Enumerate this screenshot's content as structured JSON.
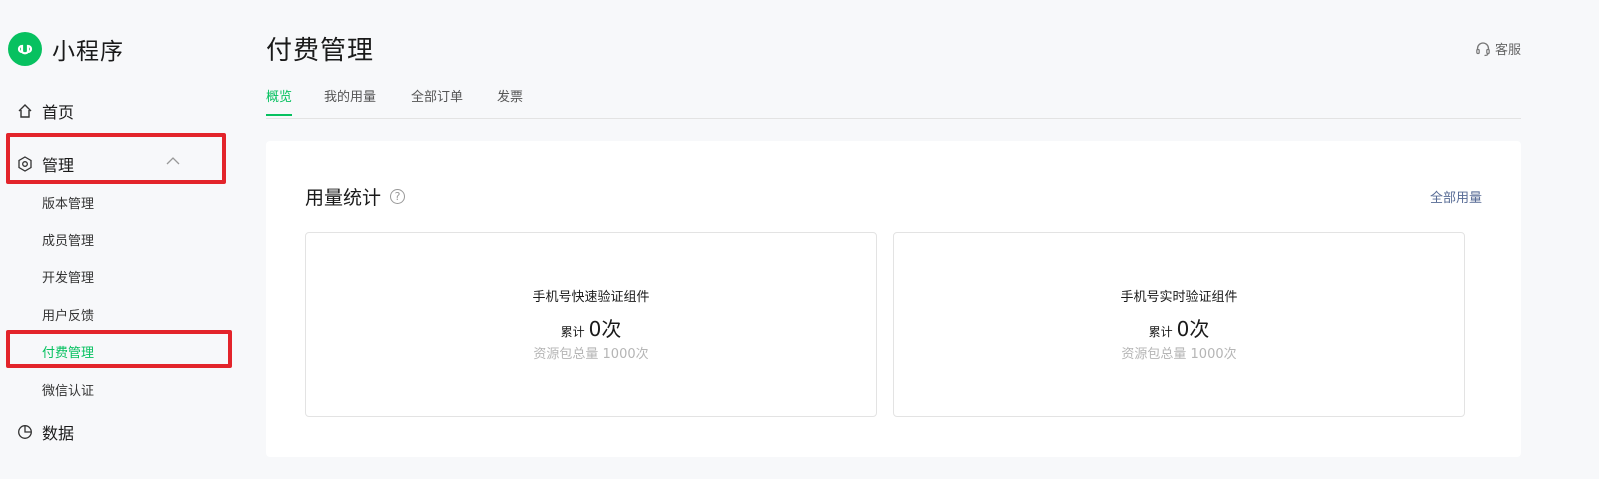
{
  "brand": {
    "name": "小程序"
  },
  "nav": {
    "home": "首页",
    "manage": "管理",
    "manage_sub": [
      "版本管理",
      "成员管理",
      "开发管理",
      "用户反馈",
      "付费管理",
      "微信认证"
    ],
    "data": "数据"
  },
  "page": {
    "title": "付费管理",
    "service": "客服"
  },
  "tabs": [
    "概览",
    "我的用量",
    "全部订单",
    "发票"
  ],
  "panel": {
    "title": "用量统计",
    "help": "?",
    "link": "全部用量",
    "cards": [
      {
        "name": "手机号快速验证组件",
        "count_label": "累计",
        "count": "0次",
        "total": "资源包总量 1000次"
      },
      {
        "name": "手机号实时验证组件",
        "count_label": "累计",
        "count": "0次",
        "total": "资源包总量 1000次"
      }
    ]
  },
  "colors": {
    "accent": "#07c160",
    "link": "#576b95",
    "highlight": "#e3242b"
  },
  "icons": [
    "miniprogram-logo-icon",
    "home-icon",
    "manage-hexagon-icon",
    "chevron-up-icon",
    "data-pie-icon",
    "headset-icon",
    "help-icon"
  ]
}
